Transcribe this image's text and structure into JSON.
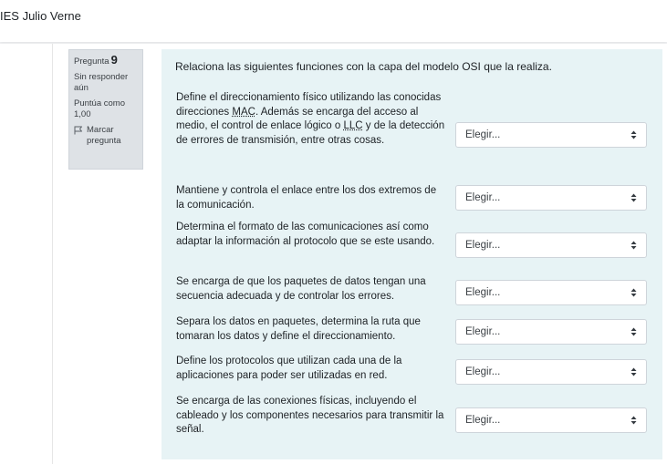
{
  "header": {
    "site_name": "IES Julio Verne"
  },
  "question_info": {
    "question_label": "Pregunta",
    "question_number": "9",
    "status": "Sin responder aún",
    "grade": "Puntúa como 1,00",
    "flag_label": "Marcar pregunta"
  },
  "question": {
    "prompt": "Relaciona las siguientes funciones con la capa del modelo OSI que la realiza.",
    "select_placeholder": "Elegir...",
    "item1": {
      "before_mac": "Define el direccionamiento físico utilizando las conocidas direcciones ",
      "mac": "MAC",
      "between": ". Además se encarga del acceso al medio, el control de enlace lógico o ",
      "llc": "LLC",
      "after_llc": " y de la detección de errores de transmisión, entre otras cosas."
    },
    "items": [
      "Mantiene y controla el enlace entre los dos extremos de la comunicación.",
      "Determina el formato de las comunicaciones así como adaptar la información al protocolo que se este usando.",
      "Se encarga de que los paquetes de datos tengan una secuencia adecuada y de controlar los errores.",
      "Separa los datos en paquetes, determina la ruta que tomaran los datos y define el direccionamiento.",
      "Define los protocolos que utilizan cada una de la aplicaciones para poder ser utilizadas en red.",
      "Se encarga de las conexiones físicas, incluyendo el cableado y los componentes necesarios para transmitir la señal."
    ]
  }
}
